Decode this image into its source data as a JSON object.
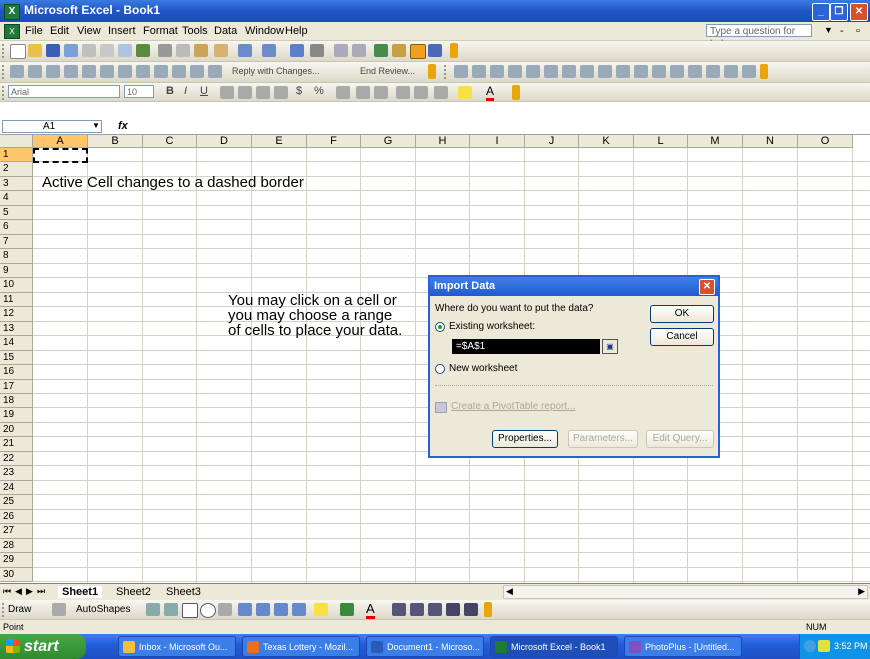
{
  "window": {
    "title": "Microsoft Excel - Book1"
  },
  "menu": {
    "items": [
      "File",
      "Edit",
      "View",
      "Insert",
      "Format",
      "Tools",
      "Data",
      "Window",
      "Help"
    ],
    "help_placeholder": "Type a question for help"
  },
  "reviewing_toolbar": {
    "reply_label": "Reply with Changes...",
    "end_review_label": "End Review..."
  },
  "formatting_toolbar": {
    "font": "Arial",
    "size": "10"
  },
  "formula_bar": {
    "name_box": "A1",
    "fx": "fx"
  },
  "grid": {
    "columns": [
      "A",
      "B",
      "C",
      "D",
      "E",
      "F",
      "G",
      "H",
      "I",
      "J",
      "K",
      "L",
      "M",
      "N",
      "O"
    ],
    "rows": [
      "1",
      "2",
      "3",
      "4",
      "5",
      "6",
      "7",
      "8",
      "9",
      "10",
      "11",
      "12",
      "13",
      "14",
      "15",
      "16",
      "17",
      "18",
      "19",
      "20",
      "21",
      "22",
      "23",
      "24",
      "25",
      "26",
      "27",
      "28",
      "29",
      "30"
    ]
  },
  "annotations": {
    "active_cell_note": "Active Cell changes to a dashed border",
    "click_note_lines": [
      "You may click on a cell or",
      "you may choose a range",
      "of cells to place your data."
    ]
  },
  "dialog": {
    "title": "Import Data",
    "question": "Where do you want to put the data?",
    "existing_label": "Existing worksheet:",
    "range_value": "=$A$1",
    "new_label": "New worksheet",
    "pivot_link": "Create a PivotTable report...",
    "ok": "OK",
    "cancel": "Cancel",
    "properties": "Properties...",
    "parameters": "Parameters...",
    "edit_query": "Edit Query..."
  },
  "sheets": [
    "Sheet1",
    "Sheet2",
    "Sheet3"
  ],
  "drawing_toolbar": {
    "draw": "Draw",
    "autoshapes": "AutoShapes"
  },
  "status": {
    "left": "Point",
    "num": "NUM"
  },
  "taskbar": {
    "start": "start",
    "tasks": [
      "Inbox - Microsoft Ou...",
      "Texas Lottery - Mozil...",
      "Document1 - Microso...",
      "Microsoft Excel - Book1",
      "PhotoPlus - [Untitled..."
    ],
    "clock": "3:52 PM"
  },
  "colors": {
    "titlebar": "#1f56c8",
    "selected_header": "#ffc66b",
    "taskbar": "#245edb",
    "start": "#2f8a2f"
  }
}
